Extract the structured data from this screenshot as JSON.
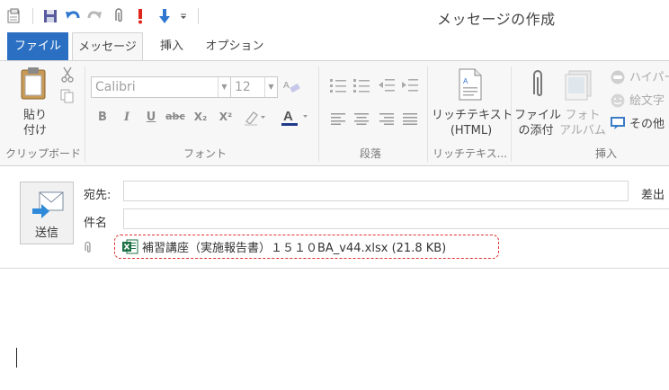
{
  "window": {
    "title": "メッセージの作成"
  },
  "tabs": [
    {
      "label": "ファイル"
    },
    {
      "label": "メッセージ"
    },
    {
      "label": "挿入"
    },
    {
      "label": "オプション"
    }
  ],
  "ribbon": {
    "clipboard": {
      "paste_label_1": "貼り",
      "paste_label_2": "付け",
      "group_label": "クリップボード"
    },
    "font": {
      "font_name": "Calibri",
      "font_size": "12",
      "group_label": "フォント",
      "bold": "B",
      "italic": "I",
      "underline": "U",
      "strike": "abc",
      "subscript": "X₂",
      "superscript": "X²"
    },
    "paragraph": {
      "group_label": "段落"
    },
    "rich_text": {
      "label_1": "リッチテキスト",
      "label_2": "(HTML)",
      "group_label": "リッチテキス..."
    },
    "insert": {
      "attach_file_1": "ファイル",
      "attach_file_2": "の添付",
      "photo_1": "フォト",
      "photo_2": "アルバム",
      "hyperlink": "ハイパー",
      "emoji": "絵文字",
      "other": "その他",
      "group_label": "挿入"
    }
  },
  "compose": {
    "send_label": "送信",
    "to_label": "宛先:",
    "subject_label": "件名",
    "from_label": "差出",
    "attachment": "補習講座（実施報告書）１５１０BA_v44.xlsx (21.8 KB)",
    "to_value": "",
    "subject_value": ""
  },
  "colors": {
    "file_tab": "#2b6fc2",
    "annotation": "#e03030",
    "excel": "#1e7145"
  }
}
